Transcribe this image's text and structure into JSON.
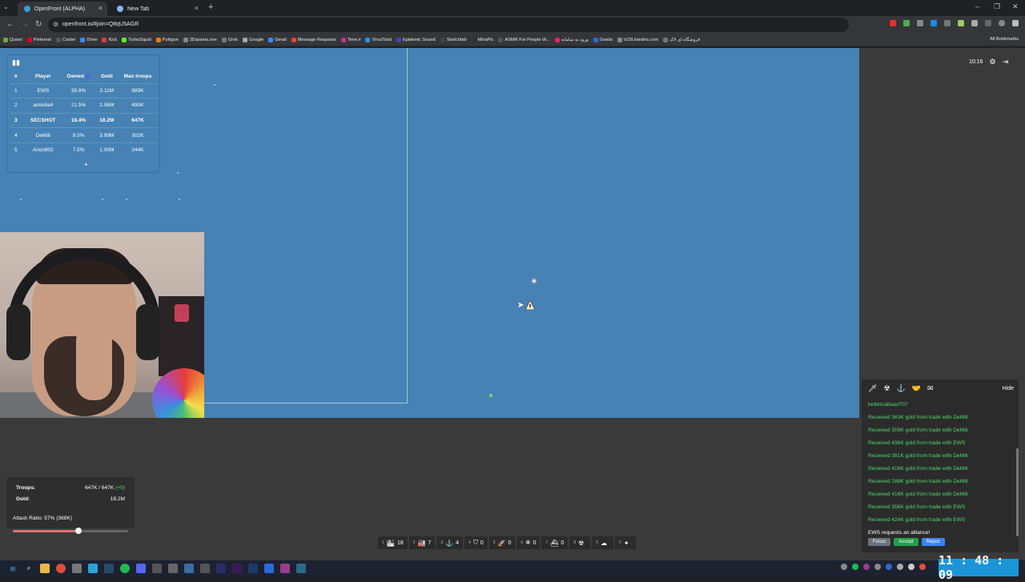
{
  "browser": {
    "tabs": [
      {
        "title": "OpenFront (ALPHA)",
        "active": true
      },
      {
        "title": "New Tab",
        "active": false
      }
    ],
    "url": "openfront.io/#join=Q8qU5AGR",
    "bookmarks": [
      "Quixel",
      "Pinterest",
      "Cooler",
      "Drive",
      "Kick",
      "TurboSquid",
      "Poliigon",
      "3Dassets.one",
      "Grok",
      "Google",
      "Gmail",
      "Message Requests",
      "Time.ir",
      "VirusTotal",
      "Epidemic Sound",
      "Sketchfab",
      "MinaPic",
      "ASMR For People W...",
      "ورود به سامانه",
      "Goods",
      "Ir23l.irandns.com",
      "فروشگاه ای لاک"
    ],
    "all_bookmarks": "All Bookmarks"
  },
  "leaderboard": {
    "headers": {
      "rank": "#",
      "player": "Player",
      "owned": "Owned",
      "gold": "Gold",
      "troops": "Max troops"
    },
    "rows": [
      {
        "rank": "1",
        "player": "EWS",
        "owned": "35.9%",
        "gold": "2.11M",
        "troops": "889K"
      },
      {
        "rank": "2",
        "player": "amin8a4",
        "owned": "21.5%",
        "gold": "2.06M",
        "troops": "490K"
      },
      {
        "rank": "3",
        "player": "SECSHOT",
        "owned": "18.4%",
        "gold": "18.2M",
        "troops": "647K"
      },
      {
        "rank": "4",
        "player": "DeMili",
        "owned": "8.5%",
        "gold": "3.99M",
        "troops": "302K"
      },
      {
        "rank": "5",
        "player": "Anon902",
        "owned": "7.5%",
        "gold": "1.00M",
        "troops": "244K"
      }
    ],
    "more": "+"
  },
  "hud": {
    "timer": "10:16"
  },
  "events": {
    "hide_label": "Hide",
    "items": [
      {
        "text": "bettercallsaul707",
        "kind": "user"
      },
      {
        "text": "Received 363K gold from trade with DeMili",
        "kind": "trade"
      },
      {
        "text": "Received 309K gold from trade with DeMili",
        "kind": "trade"
      },
      {
        "text": "Received 436K gold from trade with EWS",
        "kind": "trade"
      },
      {
        "text": "Received 381K gold from trade with DeMili",
        "kind": "trade"
      },
      {
        "text": "Received 416K gold from trade with DeMili",
        "kind": "trade"
      },
      {
        "text": "Received 288K gold from trade with DeMili",
        "kind": "trade"
      },
      {
        "text": "Received 416K gold from trade with DeMili",
        "kind": "trade"
      },
      {
        "text": "Received 356K gold from trade with EWS",
        "kind": "trade"
      },
      {
        "text": "Received 424K gold from trade with EWS",
        "kind": "trade"
      },
      {
        "text": "EWS requests an alliance!",
        "kind": "alliance"
      }
    ],
    "buttons": {
      "focus": "Focus",
      "accept": "Accept",
      "reject": "Reject"
    },
    "colors": {
      "focus": "#6b7280",
      "accept": "#22a04a",
      "reject": "#3b82f6",
      "trade": "#4fd96e"
    }
  },
  "stats": {
    "troops_label": "Troops:",
    "troops_value": "647K / 647K",
    "troops_delta": "(+0)",
    "gold_label": "Gold:",
    "gold_value": "18.2M",
    "attack_ratio": "Attack Ratio: 57% (368K)",
    "attack_ratio_percent": 57
  },
  "buildbar": [
    {
      "key": "1",
      "icon": "city-icon",
      "count": "18"
    },
    {
      "key": "2",
      "icon": "factory-icon",
      "count": "7"
    },
    {
      "key": "3",
      "icon": "port-icon",
      "count": "4"
    },
    {
      "key": "4",
      "icon": "defense-post-icon",
      "count": "0"
    },
    {
      "key": "5",
      "icon": "missile-silo-icon",
      "count": "0"
    },
    {
      "key": "6",
      "icon": "sam-launcher-icon",
      "count": "0"
    },
    {
      "key": "7",
      "icon": "warship-icon",
      "count": "0"
    },
    {
      "key": "8",
      "icon": "atom-bomb-icon",
      "count": ""
    },
    {
      "key": "9",
      "icon": "hydrogen-bomb-icon",
      "count": ""
    },
    {
      "key": "0",
      "icon": "mirv-icon",
      "count": ""
    }
  ],
  "taskbar": {
    "clock": "11 : 48 : 09"
  }
}
